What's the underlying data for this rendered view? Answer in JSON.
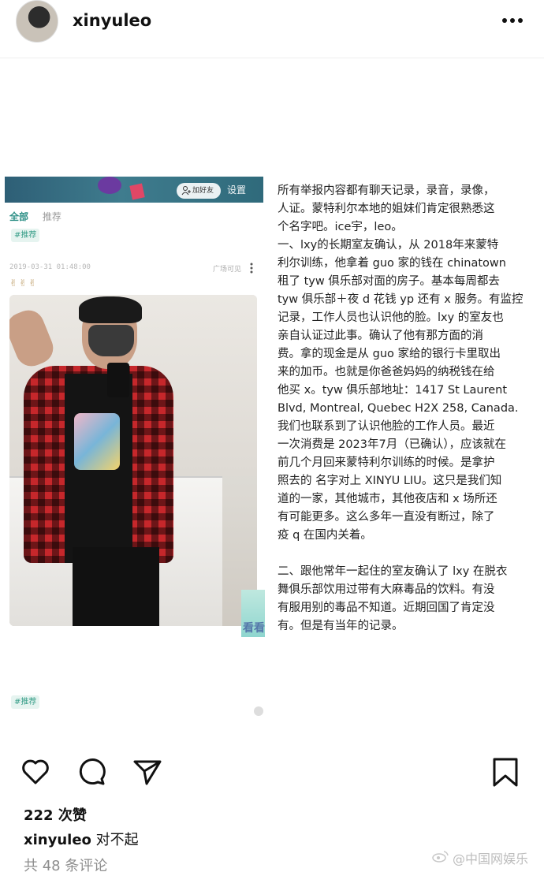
{
  "header": {
    "username": "xinyuleo",
    "more_icon": "more-horizontal-icon"
  },
  "embedded_screenshot": {
    "add_friend_label": "加好友",
    "settings_label": "设置",
    "tabs": [
      "全部",
      "推荐"
    ],
    "tag_label": "#推荐",
    "timestamp": "2019-03-31 01:48:00",
    "visibility": "广场可见",
    "emoji_row": "✌✌✌",
    "sticker_text": "看看",
    "tag_bottom_label": "#推荐"
  },
  "report": {
    "lines_p1": [
      "所有举报内容都有聊天记录，录音，录像，",
      "人证。蒙特利尔本地的姐妹们肯定很熟悉这",
      "个名字吧。ice宇，leo。",
      "一、lxy的长期室友确认，从 2018年来蒙特",
      "利尔训练，他拿着 guo 家的钱在 chinatown",
      "租了 tyw 俱乐部对面的房子。基本每周都去",
      "tyw 俱乐部＋夜 d 花钱 yp 还有 x 服务。有监控",
      "记录，工作人员也认识他的脸。lxy 的室友也",
      "亲自认证过此事。确认了他有那方面的消",
      "费。拿的现金是从 guo 家给的银行卡里取出",
      "来的加币。也就是你爸爸妈妈的纳税钱在给",
      "他买 x。tyw 俱乐部地址：1417 St Laurent",
      "Blvd, Montreal, Quebec H2X 258, Canada.",
      "我们也联系到了认识他脸的工作人员。最近",
      "一次消费是 2023年7月（已确认），应该就在",
      "前几个月回来蒙特利尔训练的时候。是拿护",
      "照去的 名字对上 XINYU LIU。这只是我们知",
      "道的一家，其他城市，其他夜店和 x 场所还",
      "有可能更多。这么多年一直没有断过，除了",
      "疫 q 在国内关着。"
    ],
    "lines_p2": [
      "二、跟他常年一起住的室友确认了 lxy 在脱衣",
      "舞俱乐部饮用过带有大麻毒品的饮料。有没",
      "有服用别的毒品不知道。近期回国了肯定没",
      "有。但是有当年的记录。"
    ]
  },
  "actions": {
    "like_icon": "heart-icon",
    "comment_icon": "comment-icon",
    "share_icon": "send-icon",
    "save_icon": "bookmark-icon"
  },
  "likes": "222 次赞",
  "caption": {
    "username": "xinyuleo",
    "text": " 对不起"
  },
  "comments_link": "共 48 条评论",
  "watermark": "@中国网娱乐",
  "colors": {
    "tag_green": "#3a9f8a",
    "banner_teal": "#3f7c8e",
    "muted_gray": "#8e8e8e"
  }
}
